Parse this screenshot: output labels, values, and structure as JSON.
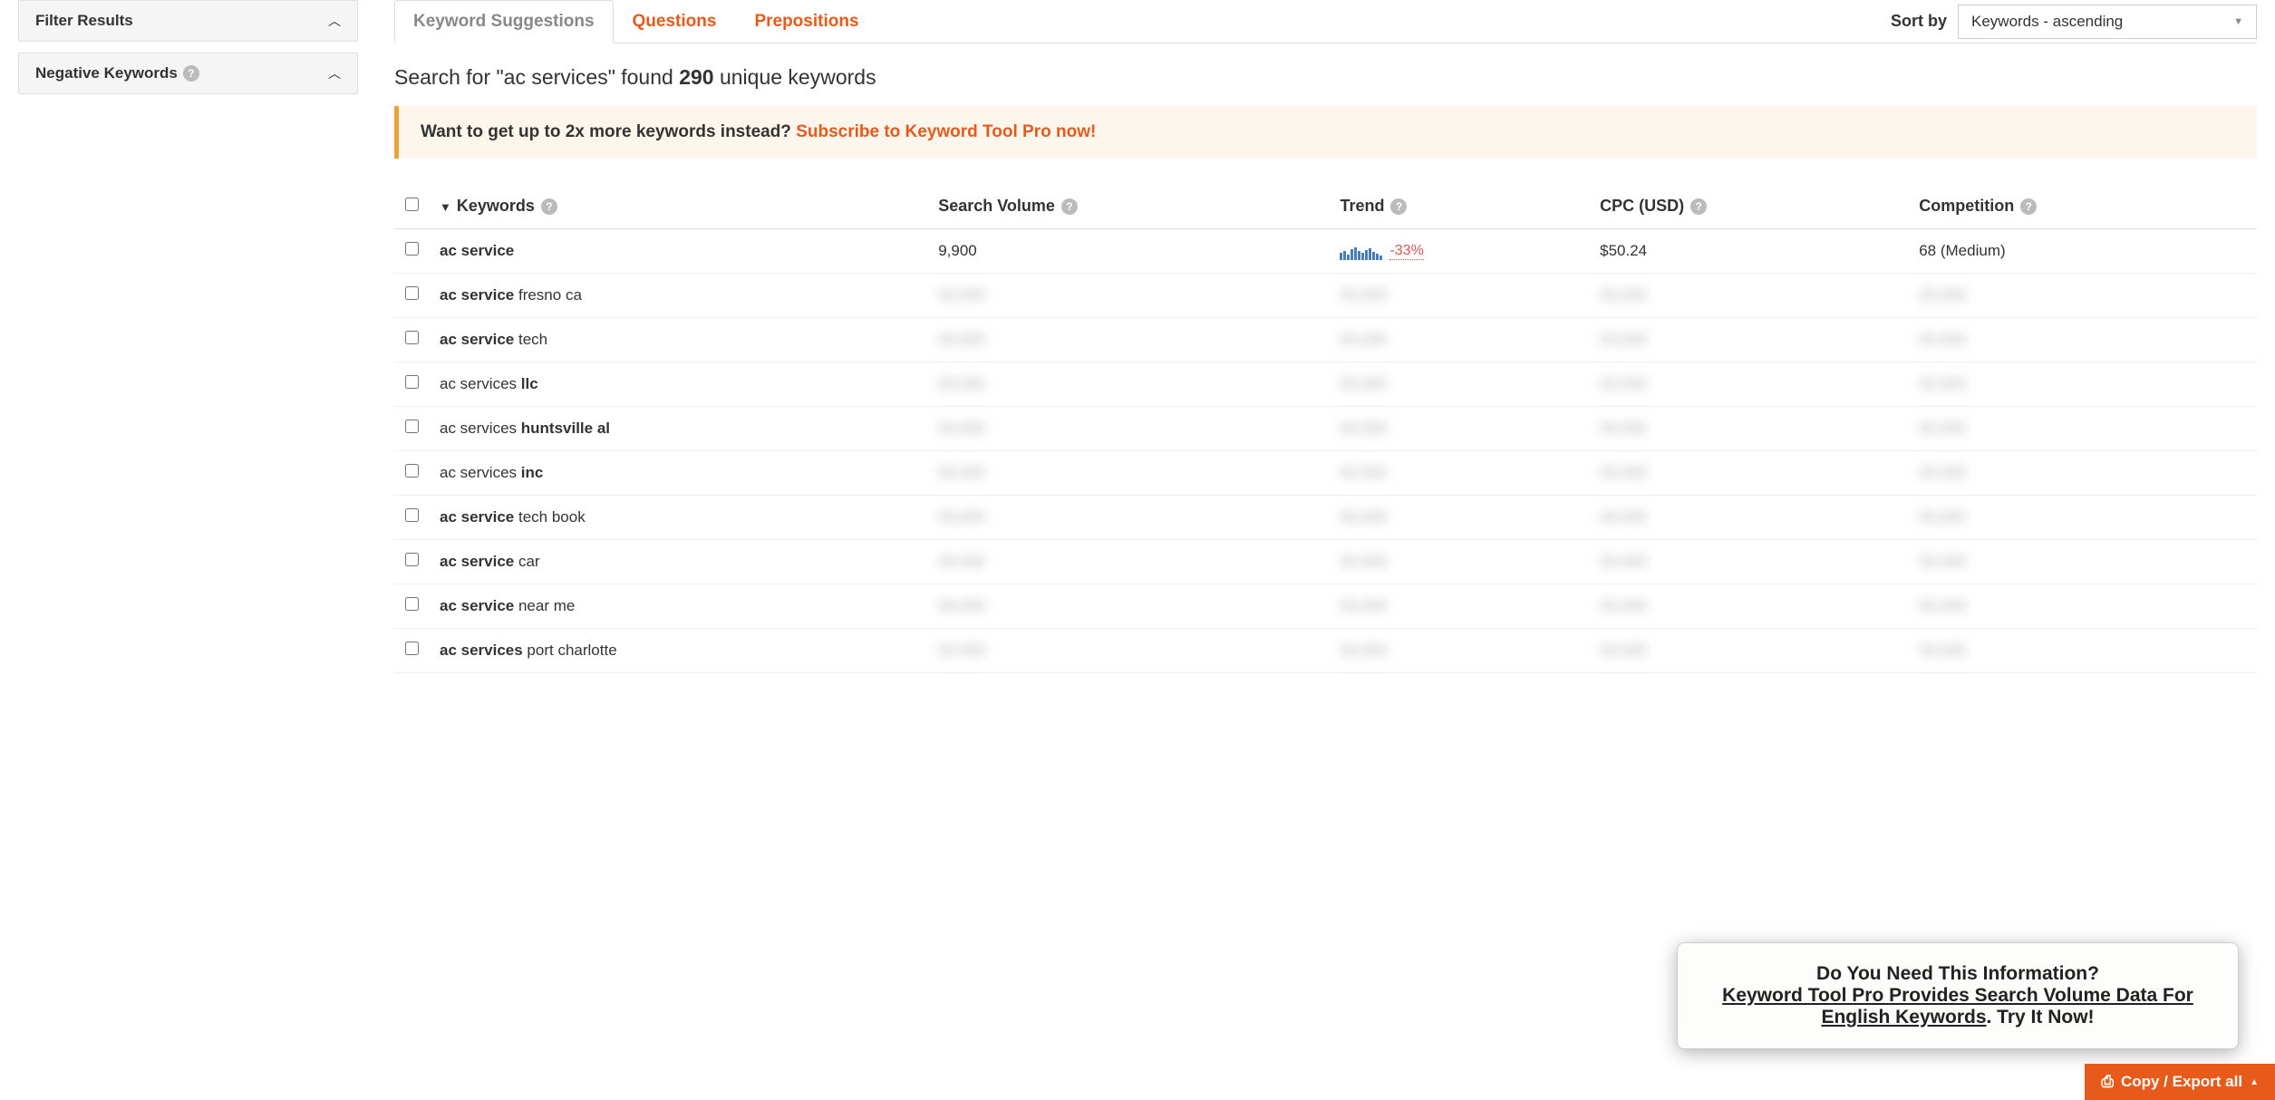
{
  "sidebar": {
    "filter_title": "Filter Results",
    "negative_title": "Negative Keywords"
  },
  "tabs": {
    "suggestions": "Keyword Suggestions",
    "questions": "Questions",
    "prepositions": "Prepositions"
  },
  "sort": {
    "label": "Sort by",
    "selected": "Keywords - ascending"
  },
  "summary": {
    "prefix": "Search for \"ac services\" found ",
    "count": "290",
    "suffix": " unique keywords"
  },
  "promo": {
    "text": "Want to get up to 2x more keywords instead? ",
    "link": "Subscribe to Keyword Tool Pro now!"
  },
  "columns": {
    "keywords": "Keywords",
    "volume": "Search Volume",
    "trend": "Trend",
    "cpc": "CPC (USD)",
    "competition": "Competition"
  },
  "rows": [
    {
      "kw_bold": "ac service",
      "kw_rest": "",
      "volume": "9,900",
      "trend": "-33%",
      "cpc": "$50.24",
      "competition": "68 (Medium)",
      "blurred": false
    },
    {
      "kw_bold": "ac service",
      "kw_rest": " fresno ca",
      "blurred": true
    },
    {
      "kw_bold": "ac service",
      "kw_rest": " tech",
      "blurred": true
    },
    {
      "kw_bold": "ac services ",
      "kw_rest": "",
      "kw_bold2": "llc",
      "blurred": true
    },
    {
      "kw_bold": "ac services ",
      "kw_rest": "",
      "kw_bold2": "huntsville al",
      "blurred": true,
      "rest_first": true
    },
    {
      "kw_bold": "ac services ",
      "kw_rest": "",
      "kw_bold2": "inc",
      "blurred": true
    },
    {
      "kw_bold": "ac service",
      "kw_rest": " tech book",
      "blurred": true
    },
    {
      "kw_bold": "ac service",
      "kw_rest": " car",
      "blurred": true
    },
    {
      "kw_bold": "ac service",
      "kw_rest": " near me",
      "blurred": true
    },
    {
      "kw_bold": "ac services",
      "kw_rest": " port charlotte",
      "blurred": true
    }
  ],
  "popup": {
    "line1": "Do You Need This Information?",
    "line2a": "Keyword Tool Pro Provides Search Volume Data For English Keywords",
    "line2b": ". Try It Now!"
  },
  "export": {
    "label": "Copy / Export all"
  }
}
